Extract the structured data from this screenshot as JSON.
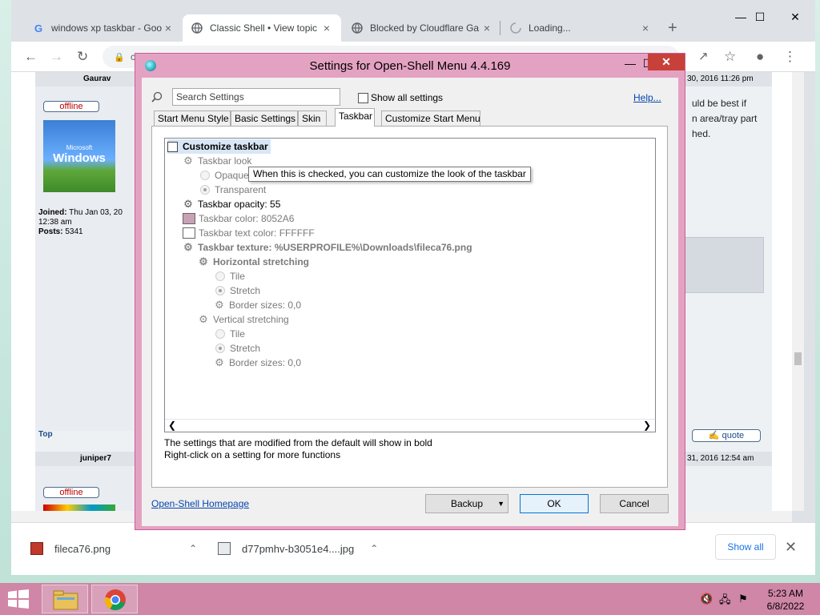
{
  "browser": {
    "tabs": [
      {
        "title": "windows xp taskbar - Goo",
        "favicon": "google-icon"
      },
      {
        "title": "Classic Shell • View topic",
        "favicon": "globe-icon"
      },
      {
        "title": "Blocked by Cloudflare Ga",
        "favicon": "globe-icon"
      },
      {
        "title": "Loading...",
        "favicon": "loading-icon"
      }
    ],
    "tab_close": "×",
    "new_tab": "+",
    "url_fragment": "c",
    "window_controls": {
      "minimize": "—",
      "maximize": "☐",
      "close": "✕"
    }
  },
  "forum": {
    "post1": {
      "author": "Gaurav",
      "status": "offline",
      "avatar_text": "Windows",
      "avatar_sub": "Microsoft",
      "joined_label": "Joined:",
      "joined_value": "Thu Jan 03, 20",
      "joined_time": "12:38 am",
      "posts_label": "Posts:",
      "posts_value": "5341",
      "date": "30, 2016 11:26 pm",
      "text_lines": [
        "uld be best if",
        "n area/tray part",
        "hed."
      ],
      "top_link": "Top",
      "quote": "quote"
    },
    "post2": {
      "author": "juniper7",
      "status": "offline",
      "date": "31, 2016 12:54 am"
    }
  },
  "downloads": {
    "items": [
      {
        "name": "fileca76.png"
      },
      {
        "name": "d77pmhv-b3051e4....jpg"
      }
    ],
    "show_all": "Show all",
    "close": "✕"
  },
  "dialog": {
    "title": "Settings for Open-Shell Menu 4.4.169",
    "close": "✕",
    "search_placeholder": "Search Settings",
    "show_all_settings": "Show all settings",
    "help": "Help...",
    "tabs": [
      "Start Menu Style",
      "Basic Settings",
      "Skin",
      "Taskbar",
      "Customize Start Menu"
    ],
    "active_tab": "Taskbar",
    "tree": {
      "root": "Customize taskbar",
      "taskbar_look": "Taskbar look",
      "opaque": "Opaque",
      "transparent": "Transparent",
      "opacity": "Taskbar opacity: 55",
      "color": "Taskbar color: 8052A6",
      "text_color": "Taskbar text color: FFFFFF",
      "texture": "Taskbar texture: %USERPROFILE%\\Downloads\\fileca76.png",
      "horizontal": "Horizontal stretching",
      "h_tile": "Tile",
      "h_stretch": "Stretch",
      "h_border": "Border sizes: 0,0",
      "vertical": "Vertical stretching",
      "v_tile": "Tile",
      "v_stretch": "Stretch",
      "v_border": "Border sizes: 0,0"
    },
    "swatch_colors": {
      "taskbar": "#c9a1b4",
      "text": "#ffffff"
    },
    "tooltip": "When this is checked, you can customize the look of the taskbar",
    "info_line1": "The settings that are modified from the default will show in bold",
    "info_line2": "Right-click on a setting for more functions",
    "homepage": "Open-Shell Homepage",
    "backup": "Backup",
    "ok": "OK",
    "cancel": "Cancel"
  },
  "taskbar": {
    "time": "5:23 AM",
    "date": "6/8/2022"
  }
}
